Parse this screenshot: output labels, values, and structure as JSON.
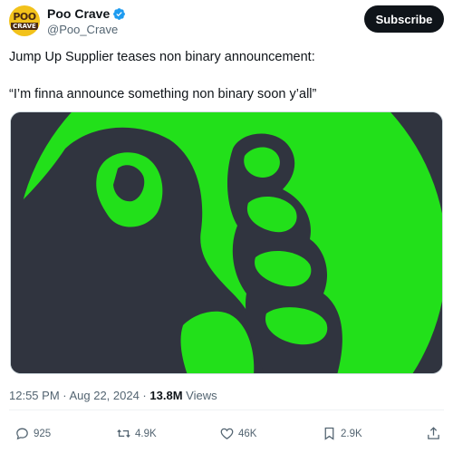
{
  "author": {
    "display_name": "Poo Crave",
    "handle": "@Poo_Crave",
    "avatar_text_top": "POO",
    "avatar_text_bottom": "CRAVE",
    "verified_color": "#1d9bf0"
  },
  "subscribe_label": "Subscribe",
  "post": {
    "line1": "Jump Up Supplier teases non binary announcement:",
    "line2": "“I’m finna announce something non binary soon y’all”"
  },
  "media": {
    "bg_color": "#30343f",
    "accent_color": "#22e01a"
  },
  "meta": {
    "timestamp": "12:55 PM · Aug 22, 2024 · ",
    "views_count": "13.8M",
    "views_label": " Views"
  },
  "actions": {
    "replies": "925",
    "reposts": "4.9K",
    "likes": "46K",
    "bookmarks": "2.9K"
  }
}
